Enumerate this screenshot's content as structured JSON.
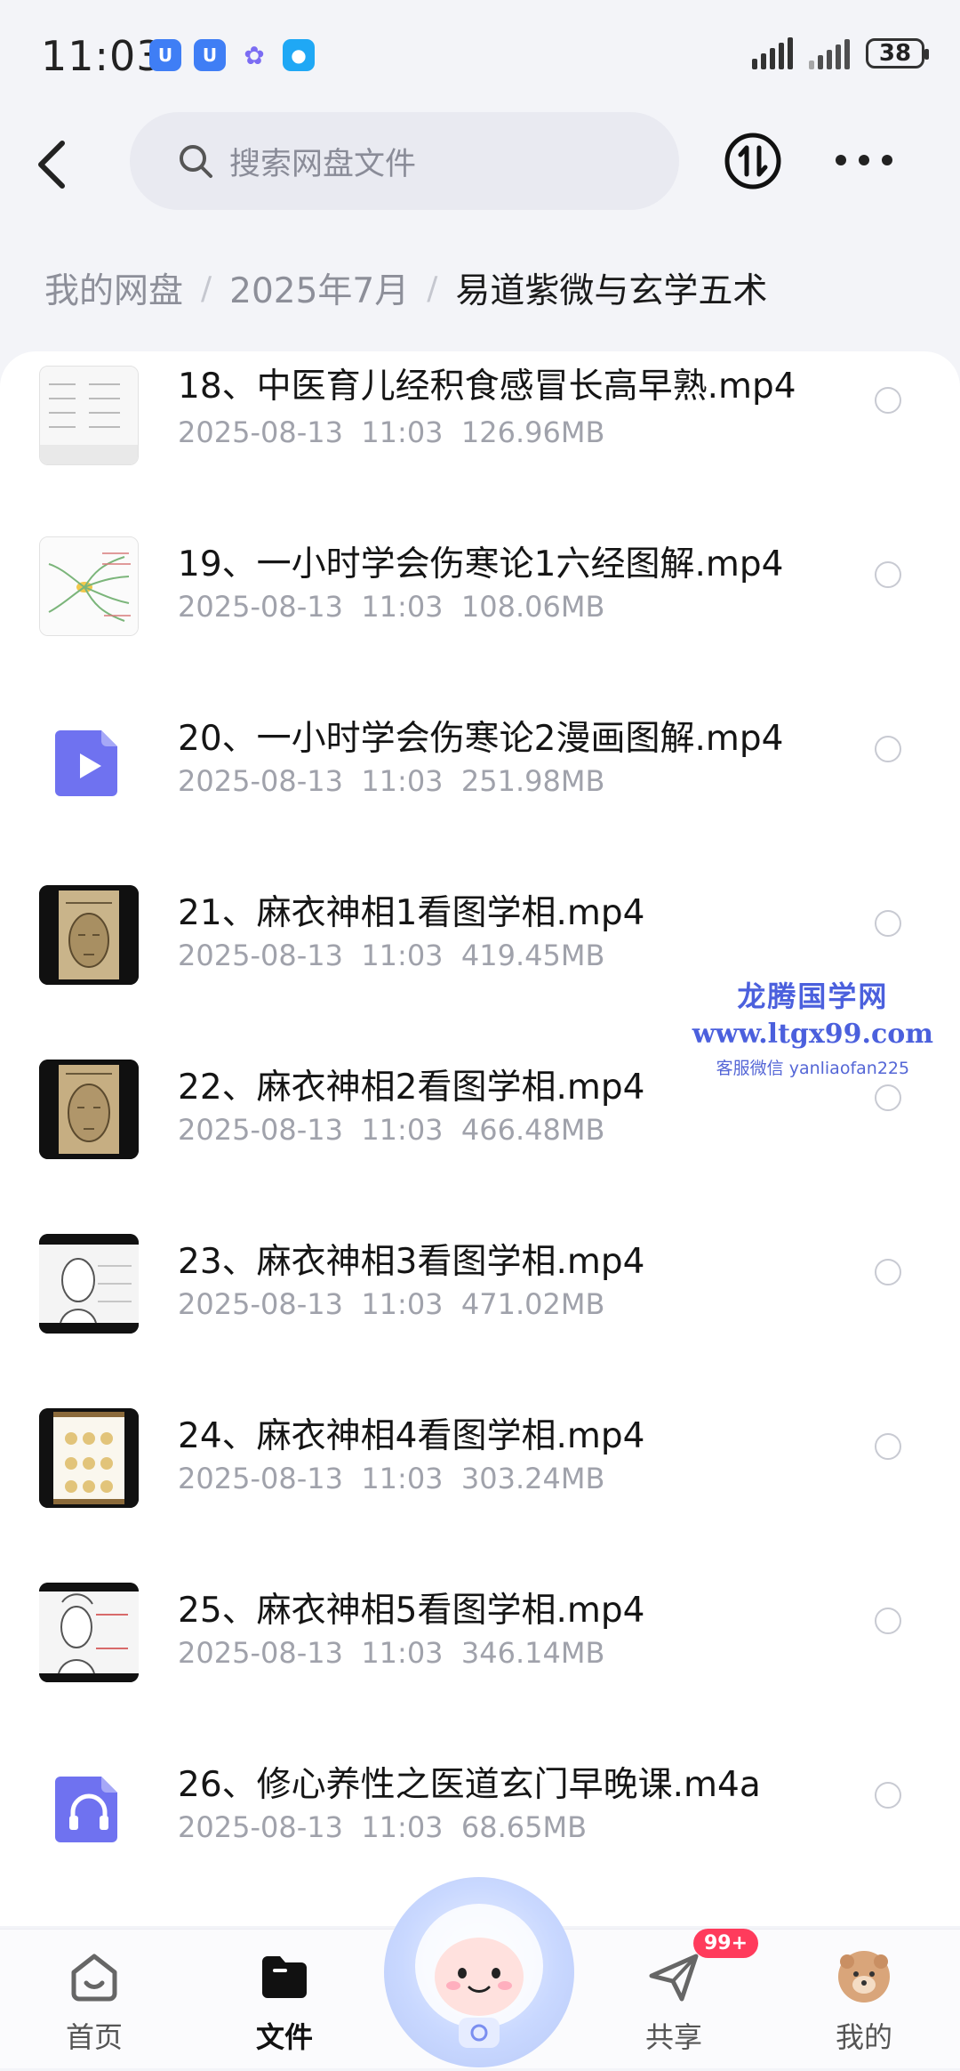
{
  "status_bar": {
    "time": "11:03",
    "battery": "38"
  },
  "search": {
    "placeholder": "搜索网盘文件"
  },
  "breadcrumb": {
    "items": [
      "我的网盘",
      "2025年7月",
      "易道紫微与玄学五术"
    ]
  },
  "files": [
    {
      "name": "18、中医育儿经积食感冒长高早熟.mp4",
      "date": "2025-08-13",
      "time": "11:03",
      "size": "126.96MB",
      "thumb": "doc"
    },
    {
      "name": "19、一小时学会伤寒论1六经图解.mp4",
      "date": "2025-08-13",
      "time": "11:03",
      "size": "108.06MB",
      "thumb": "mindmap"
    },
    {
      "name": "20、一小时学会伤寒论2漫画图解.mp4",
      "date": "2025-08-13",
      "time": "11:03",
      "size": "251.98MB",
      "thumb": "video-icon"
    },
    {
      "name": "21、麻衣神相1看图学相.mp4",
      "date": "2025-08-13",
      "time": "11:03",
      "size": "419.45MB",
      "thumb": "face-dark"
    },
    {
      "name": "22、麻衣神相2看图学相.mp4",
      "date": "2025-08-13",
      "time": "11:03",
      "size": "466.48MB",
      "thumb": "face-dark"
    },
    {
      "name": "23、麻衣神相3看图学相.mp4",
      "date": "2025-08-13",
      "time": "11:03",
      "size": "471.02MB",
      "thumb": "face-light"
    },
    {
      "name": "24、麻衣神相4看图学相.mp4",
      "date": "2025-08-13",
      "time": "11:03",
      "size": "303.24MB",
      "thumb": "scroll"
    },
    {
      "name": "25、麻衣神相5看图学相.mp4",
      "date": "2025-08-13",
      "time": "11:03",
      "size": "346.14MB",
      "thumb": "face-light"
    },
    {
      "name": "26、修心养性之医道玄门早晚课.m4a",
      "date": "2025-08-13",
      "time": "11:03",
      "size": "68.65MB",
      "thumb": "audio-icon"
    }
  ],
  "watermark": {
    "title": "龙腾国学网",
    "url": "www.ltgx99.com",
    "contact": "客服微信 yanliaofan225"
  },
  "bottom_nav": {
    "items": [
      {
        "label": "首页",
        "icon": "home-icon",
        "active": false
      },
      {
        "label": "文件",
        "icon": "folder-icon",
        "active": true
      },
      {
        "label": "共享",
        "icon": "share-icon",
        "active": false
      },
      {
        "label": "我的",
        "icon": "avatar-icon",
        "active": false
      }
    ],
    "share_badge": "99+"
  },
  "colors": {
    "accent_file_icon": "#6f72f0",
    "badge": "#ff3b5c",
    "watermark": "#4b60dd"
  }
}
